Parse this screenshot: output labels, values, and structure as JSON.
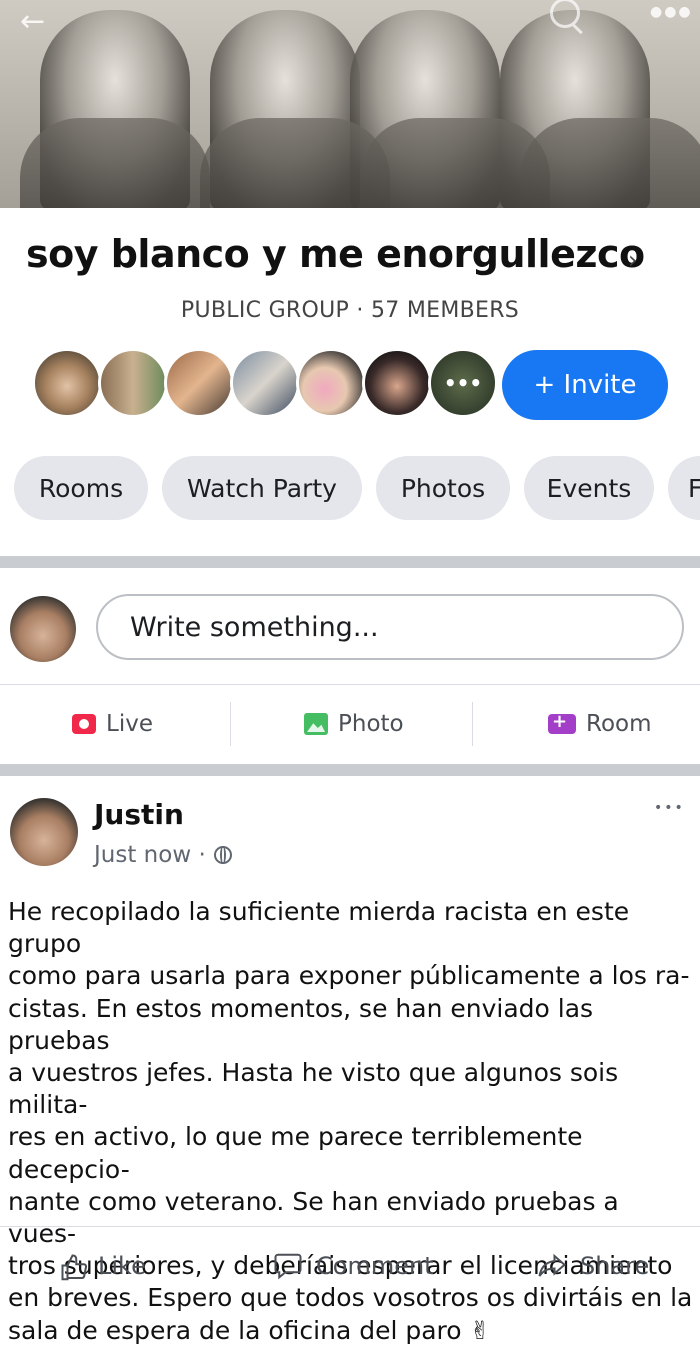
{
  "group": {
    "name": "soy blanco y me enorgullezco",
    "meta": "PUBLIC GROUP · 57 MEMBERS",
    "invite_label": "+ Invite",
    "more_members_glyph": "•••"
  },
  "tabs": [
    {
      "label": "Rooms"
    },
    {
      "label": "Watch Party"
    },
    {
      "label": "Photos"
    },
    {
      "label": "Events"
    },
    {
      "label": "F"
    }
  ],
  "composer": {
    "placeholder": "Write something...",
    "actions": [
      {
        "label": "Live",
        "icon": "live-icon"
      },
      {
        "label": "Photo",
        "icon": "photo-icon"
      },
      {
        "label": "Room",
        "icon": "room-icon"
      }
    ]
  },
  "post": {
    "author": "Justin",
    "time": "Just now ·",
    "text": "He recopilado la suficiente mierda racista en este grupo\ncomo para usarla para exponer públicamente a los ra-\ncistas. En estos momentos, se han enviado las pruebas\na vuestros jefes. Hasta he visto que algunos sois milita-\nres en activo, lo que me parece terriblemente decepcio-\nnante como veterano. Se han enviado pruebas a vues-\ntros superiores, y deberíais esperar el licenciamiento\nen breves. Espero que todos vosotros os divirtáis en la\nsala de espera de la oficina del paro ✌",
    "more_glyph": "•••",
    "reactions": [
      {
        "label": "Like",
        "icon": "thumbs-up-icon"
      },
      {
        "label": "Comment",
        "icon": "comment-icon"
      },
      {
        "label": "Share",
        "icon": "share-icon"
      }
    ]
  },
  "colors": {
    "accent": "#1877f2",
    "chip_bg": "#e4e6eb",
    "separator": "#c9ccd1",
    "live": "#f02849",
    "photo": "#45bd62",
    "room": "#a33ec8"
  }
}
